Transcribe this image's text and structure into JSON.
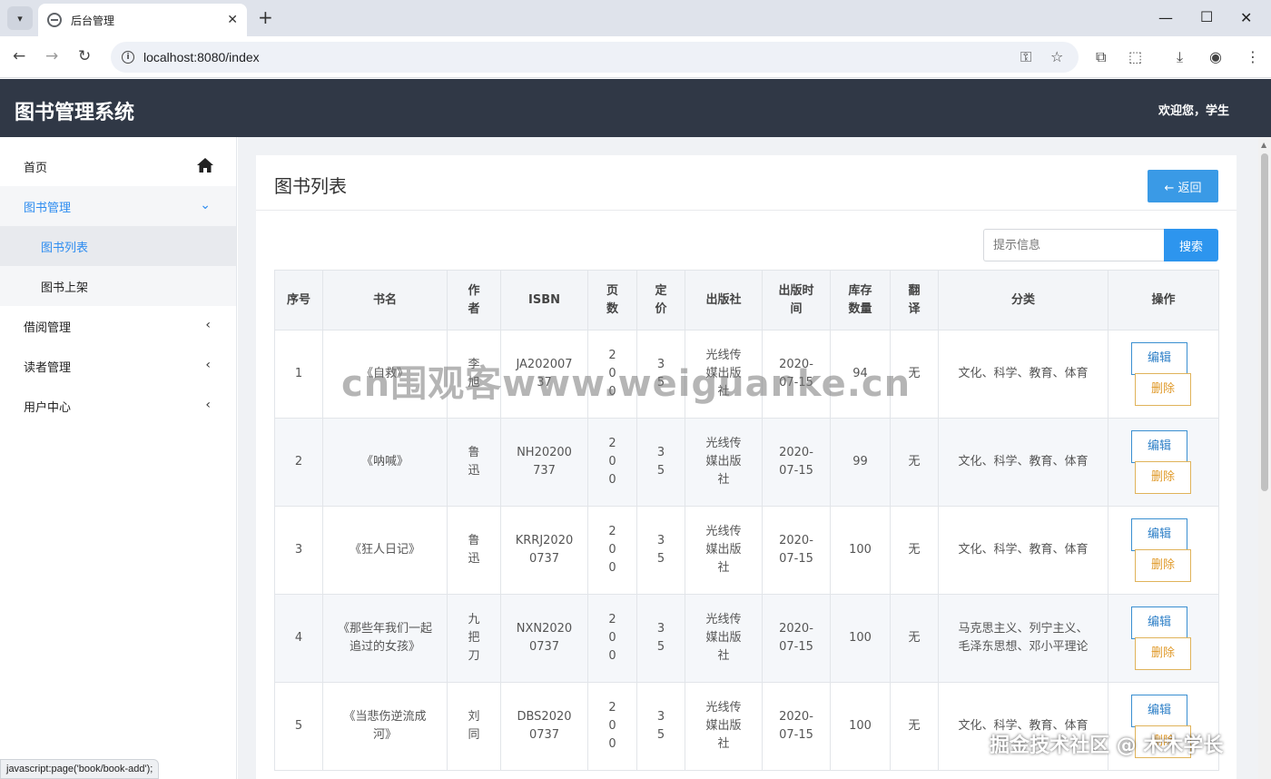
{
  "browser": {
    "tab_title": "后台管理",
    "url": "localhost:8080/index",
    "status_url": "javascript:page('book/book-add');"
  },
  "header": {
    "app_title": "图书管理系统",
    "welcome": "欢迎您，学生"
  },
  "sidebar": {
    "items": [
      {
        "label": "首页",
        "icon": "home-icon"
      },
      {
        "label": "图书管理",
        "icon": "chevron-down-icon"
      },
      {
        "label": "图书列表"
      },
      {
        "label": "图书上架"
      },
      {
        "label": "借阅管理",
        "icon": "chevron-left-icon"
      },
      {
        "label": "读者管理",
        "icon": "chevron-left-icon"
      },
      {
        "label": "用户中心",
        "icon": "chevron-left-icon"
      }
    ]
  },
  "main": {
    "title": "图书列表",
    "back_label": "← 返回",
    "search_placeholder": "提示信息",
    "search_label": "搜索",
    "table": {
      "headers": [
        "序号",
        "书名",
        "作者",
        "ISBN",
        "页数",
        "定价",
        "出版社",
        "出版时间",
        "库存数量",
        "翻译",
        "分类",
        "操作"
      ],
      "rows": [
        {
          "no": "1",
          "title": "《自救》",
          "author": "李旭",
          "isbn": "JA20200737",
          "pages": "200",
          "price": "35",
          "publisher": "光线传媒出版社",
          "date": "2020-07-15",
          "stock": "94",
          "translate": "无",
          "category": "文化、科学、教育、体育"
        },
        {
          "no": "2",
          "title": "《呐喊》",
          "author": "鲁迅",
          "isbn": "NH20200737",
          "pages": "200",
          "price": "35",
          "publisher": "光线传媒出版社",
          "date": "2020-07-15",
          "stock": "99",
          "translate": "无",
          "category": "文化、科学、教育、体育"
        },
        {
          "no": "3",
          "title": "《狂人日记》",
          "author": "鲁迅",
          "isbn": "KRRJ20200737",
          "pages": "200",
          "price": "35",
          "publisher": "光线传媒出版社",
          "date": "2020-07-15",
          "stock": "100",
          "translate": "无",
          "category": "文化、科学、教育、体育"
        },
        {
          "no": "4",
          "title": "《那些年我们一起追过的女孩》",
          "author": "九把刀",
          "isbn": "NXN20200737",
          "pages": "200",
          "price": "35",
          "publisher": "光线传媒出版社",
          "date": "2020-07-15",
          "stock": "100",
          "translate": "无",
          "category": "马克思主义、列宁主义、毛泽东思想、邓小平理论"
        },
        {
          "no": "5",
          "title": "《当悲伤逆流成河》",
          "author": "刘同",
          "isbn": "DBS20200737",
          "pages": "200",
          "price": "35",
          "publisher": "光线传媒出版社",
          "date": "2020-07-15",
          "stock": "100",
          "translate": "无",
          "category": "文化、科学、教育、体育"
        }
      ],
      "edit_label": "编辑",
      "delete_label": "删除"
    }
  },
  "watermarks": {
    "center": "cn围观客www.weiguanke.cn",
    "corner": "掘金技术社区 @ 木木学长"
  }
}
